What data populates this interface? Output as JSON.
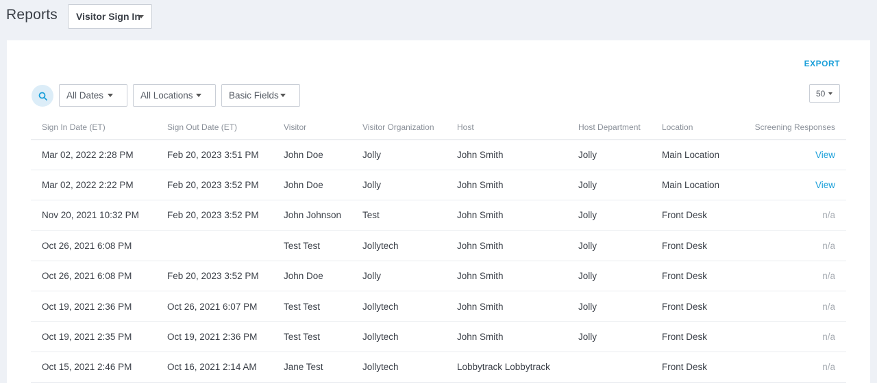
{
  "header": {
    "title": "Reports",
    "report_type": "Visitor Sign In"
  },
  "toolbar": {
    "export_label": "EXPORT",
    "filters": {
      "dates": "All Dates",
      "locations": "All Locations",
      "fields": "Basic Fields"
    },
    "per_page": "50"
  },
  "table": {
    "columns": [
      "Sign In Date (ET)",
      "Sign Out Date (ET)",
      "Visitor",
      "Visitor Organization",
      "Host",
      "Host Department",
      "Location",
      "Screening Responses"
    ],
    "rows": [
      [
        "Mar 02, 2022 2:28 PM",
        "Feb 20, 2023 3:51 PM",
        "John Doe",
        "Jolly",
        "John Smith",
        "Jolly",
        "Main Location",
        "View"
      ],
      [
        "Mar 02, 2022 2:22 PM",
        "Feb 20, 2023 3:52 PM",
        "John Doe",
        "Jolly",
        "John Smith",
        "Jolly",
        "Main Location",
        "View"
      ],
      [
        "Nov 20, 2021 10:32 PM",
        "Feb 20, 2023 3:52 PM",
        "John Johnson",
        "Test",
        "John Smith",
        "Jolly",
        "Front Desk",
        "n/a"
      ],
      [
        "Oct 26, 2021 6:08 PM",
        "",
        "Test Test",
        "Jollytech",
        "John Smith",
        "Jolly",
        "Front Desk",
        "n/a"
      ],
      [
        "Oct 26, 2021 6:08 PM",
        "Feb 20, 2023 3:52 PM",
        "John Doe",
        "Jolly",
        "John Smith",
        "Jolly",
        "Front Desk",
        "n/a"
      ],
      [
        "Oct 19, 2021 2:36 PM",
        "Oct 26, 2021 6:07 PM",
        "Test Test",
        "Jollytech",
        "John Smith",
        "Jolly",
        "Front Desk",
        "n/a"
      ],
      [
        "Oct 19, 2021 2:35 PM",
        "Oct 19, 2021 2:36 PM",
        "Test Test",
        "Jollytech",
        "John Smith",
        "Jolly",
        "Front Desk",
        "n/a"
      ],
      [
        "Oct 15, 2021 2:46 PM",
        "Oct 16, 2021 2:14 AM",
        "Jane Test",
        "Jollytech",
        "Lobbytrack Lobbytrack",
        "",
        "Front Desk",
        "n/a"
      ]
    ]
  },
  "colors": {
    "accent": "#1a9fd9",
    "background": "#eef1f6"
  }
}
